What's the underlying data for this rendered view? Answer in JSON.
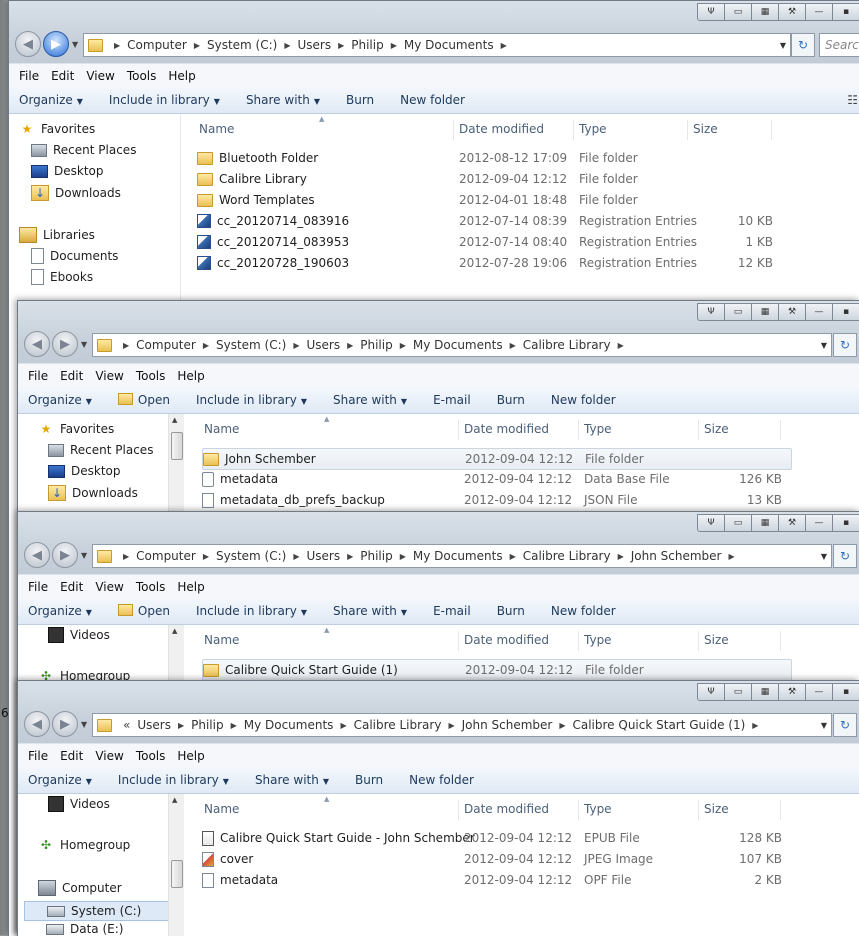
{
  "menu": [
    "File",
    "Edit",
    "View",
    "Tools",
    "Help"
  ],
  "columns": {
    "name": "Name",
    "date": "Date modified",
    "type": "Type",
    "size": "Size"
  },
  "search_placeholder": "Search",
  "win1": {
    "path": [
      "Computer",
      "System (C:)",
      "Users",
      "Philip",
      "My Documents"
    ],
    "toolbar": [
      "Organize",
      "Include in library",
      "Share with",
      "Burn",
      "New folder"
    ],
    "nav": [
      {
        "label": "Favorites",
        "icon": "star-icon"
      },
      {
        "label": "Recent Places",
        "icon": "recent-places-icon"
      },
      {
        "label": "Desktop",
        "icon": "desktop-icon"
      },
      {
        "label": "Downloads",
        "icon": "downloads-icon"
      },
      {
        "label": "Libraries",
        "icon": "libraries-icon"
      },
      {
        "label": "Documents",
        "icon": "documents-icon"
      },
      {
        "label": "Ebooks",
        "icon": "ebooks-icon"
      }
    ],
    "files": [
      {
        "name": "Bluetooth Folder",
        "date": "2012-08-12 17:09",
        "type": "File folder",
        "size": "",
        "icon": "folder-icon"
      },
      {
        "name": "Calibre Library",
        "date": "2012-09-04 12:12",
        "type": "File folder",
        "size": "",
        "icon": "folder-icon"
      },
      {
        "name": "Word Templates",
        "date": "2012-04-01 18:48",
        "type": "File folder",
        "size": "",
        "icon": "folder-icon"
      },
      {
        "name": "cc_20120714_083916",
        "date": "2012-07-14 08:39",
        "type": "Registration Entries",
        "size": "10 KB",
        "icon": "registry-file-icon"
      },
      {
        "name": "cc_20120714_083953",
        "date": "2012-07-14 08:40",
        "type": "Registration Entries",
        "size": "1 KB",
        "icon": "registry-file-icon"
      },
      {
        "name": "cc_20120728_190603",
        "date": "2012-07-28 19:06",
        "type": "Registration Entries",
        "size": "12 KB",
        "icon": "registry-file-icon"
      }
    ]
  },
  "win2": {
    "path": [
      "Computer",
      "System (C:)",
      "Users",
      "Philip",
      "My Documents",
      "Calibre Library"
    ],
    "toolbar": [
      "Organize",
      "Open",
      "Include in library",
      "Share with",
      "E-mail",
      "Burn",
      "New folder"
    ],
    "nav": [
      {
        "label": "Favorites",
        "icon": "star-icon"
      },
      {
        "label": "Recent Places",
        "icon": "recent-places-icon"
      },
      {
        "label": "Desktop",
        "icon": "desktop-icon"
      },
      {
        "label": "Downloads",
        "icon": "downloads-icon"
      }
    ],
    "files": [
      {
        "name": "John Schember",
        "date": "2012-09-04 12:12",
        "type": "File folder",
        "size": "",
        "icon": "folder-icon"
      },
      {
        "name": "metadata",
        "date": "2012-09-04 12:12",
        "type": "Data Base File",
        "size": "126 KB",
        "icon": "database-file-icon"
      },
      {
        "name": "metadata_db_prefs_backup",
        "date": "2012-09-04 12:12",
        "type": "JSON File",
        "size": "13 KB",
        "icon": "document-file-icon"
      }
    ]
  },
  "win3": {
    "path": [
      "Computer",
      "System (C:)",
      "Users",
      "Philip",
      "My Documents",
      "Calibre Library",
      "John Schember"
    ],
    "toolbar": [
      "Organize",
      "Open",
      "Include in library",
      "Share with",
      "E-mail",
      "Burn",
      "New folder"
    ],
    "nav": [
      {
        "label": "Videos",
        "icon": "videos-icon"
      },
      {
        "label": "Homegroup",
        "icon": "homegroup-icon"
      }
    ],
    "files": [
      {
        "name": "Calibre Quick Start Guide (1)",
        "date": "2012-09-04 12:12",
        "type": "File folder",
        "size": "",
        "icon": "folder-icon"
      }
    ]
  },
  "win4": {
    "path_prefix": "«",
    "path": [
      "Users",
      "Philip",
      "My Documents",
      "Calibre Library",
      "John Schember",
      "Calibre Quick Start Guide (1)"
    ],
    "toolbar": [
      "Organize",
      "Include in library",
      "Share with",
      "Burn",
      "New folder"
    ],
    "nav": [
      {
        "label": "Videos",
        "icon": "videos-icon"
      },
      {
        "label": "Homegroup",
        "icon": "homegroup-icon"
      },
      {
        "label": "Computer",
        "icon": "computer-icon"
      },
      {
        "label": "System (C:)",
        "icon": "drive-icon"
      },
      {
        "label": "Data (E:)",
        "icon": "drive-icon"
      }
    ],
    "files": [
      {
        "name": "Calibre Quick Start Guide - John Schember",
        "date": "2012-09-04 12:12",
        "type": "EPUB File",
        "size": "128 KB",
        "icon": "epub-file-icon"
      },
      {
        "name": "cover",
        "date": "2012-09-04 12:12",
        "type": "JPEG Image",
        "size": "107 KB",
        "icon": "image-file-icon"
      },
      {
        "name": "metadata",
        "date": "2012-09-04 12:12",
        "type": "OPF File",
        "size": "2 KB",
        "icon": "document-file-icon"
      }
    ]
  },
  "left_edge_char": "6"
}
